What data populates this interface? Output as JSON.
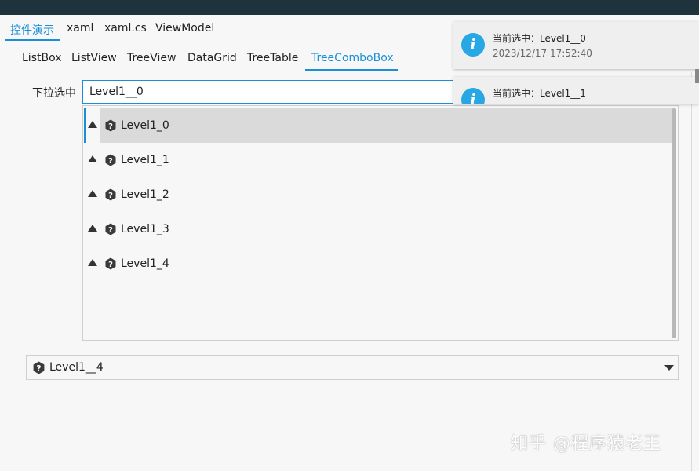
{
  "top_tabs": [
    {
      "label": "控件演示",
      "active": true
    },
    {
      "label": "xaml",
      "active": false
    },
    {
      "label": "xaml.cs",
      "active": false
    },
    {
      "label": "ViewModel",
      "active": false
    }
  ],
  "sub_tabs": [
    {
      "label": "ListBox",
      "active": false
    },
    {
      "label": "ListView",
      "active": false
    },
    {
      "label": "TreeView",
      "active": false
    },
    {
      "label": "DataGrid",
      "active": false
    },
    {
      "label": "TreeTable",
      "active": false
    },
    {
      "label": "TreeComboBox",
      "active": true
    }
  ],
  "form": {
    "label": "下拉选中",
    "value": "Level1__0"
  },
  "dropdown": {
    "items": [
      {
        "label": "Level1_0",
        "icon": "help-hexagon-icon",
        "expander": "triangle-up-icon",
        "selected": true
      },
      {
        "label": "Level1_1",
        "icon": "help-hexagon-icon",
        "expander": "triangle-up-icon",
        "selected": false
      },
      {
        "label": "Level1_2",
        "icon": "help-hexagon-icon",
        "expander": "triangle-up-icon",
        "selected": false
      },
      {
        "label": "Level1_3",
        "icon": "help-hexagon-icon",
        "expander": "triangle-up-icon",
        "selected": false
      },
      {
        "label": "Level1_4",
        "icon": "help-hexagon-icon",
        "expander": "triangle-up-icon",
        "selected": false
      }
    ]
  },
  "second_combo": {
    "value": "Level1__4",
    "icon": "help-hexagon-icon"
  },
  "notifications": [
    {
      "message": "当前选中：Level1__0",
      "time": "2023/12/17 17:52:40",
      "icon": "info-icon"
    },
    {
      "message": "当前选中：Level1__1",
      "time": "",
      "icon": "info-icon"
    }
  ],
  "watermark": "知乎 @程序猿老王",
  "colors": {
    "accent": "#1a8fd6",
    "titlebar": "#1f333d",
    "info": "#27a7e3",
    "selected_row": "#dadada"
  }
}
